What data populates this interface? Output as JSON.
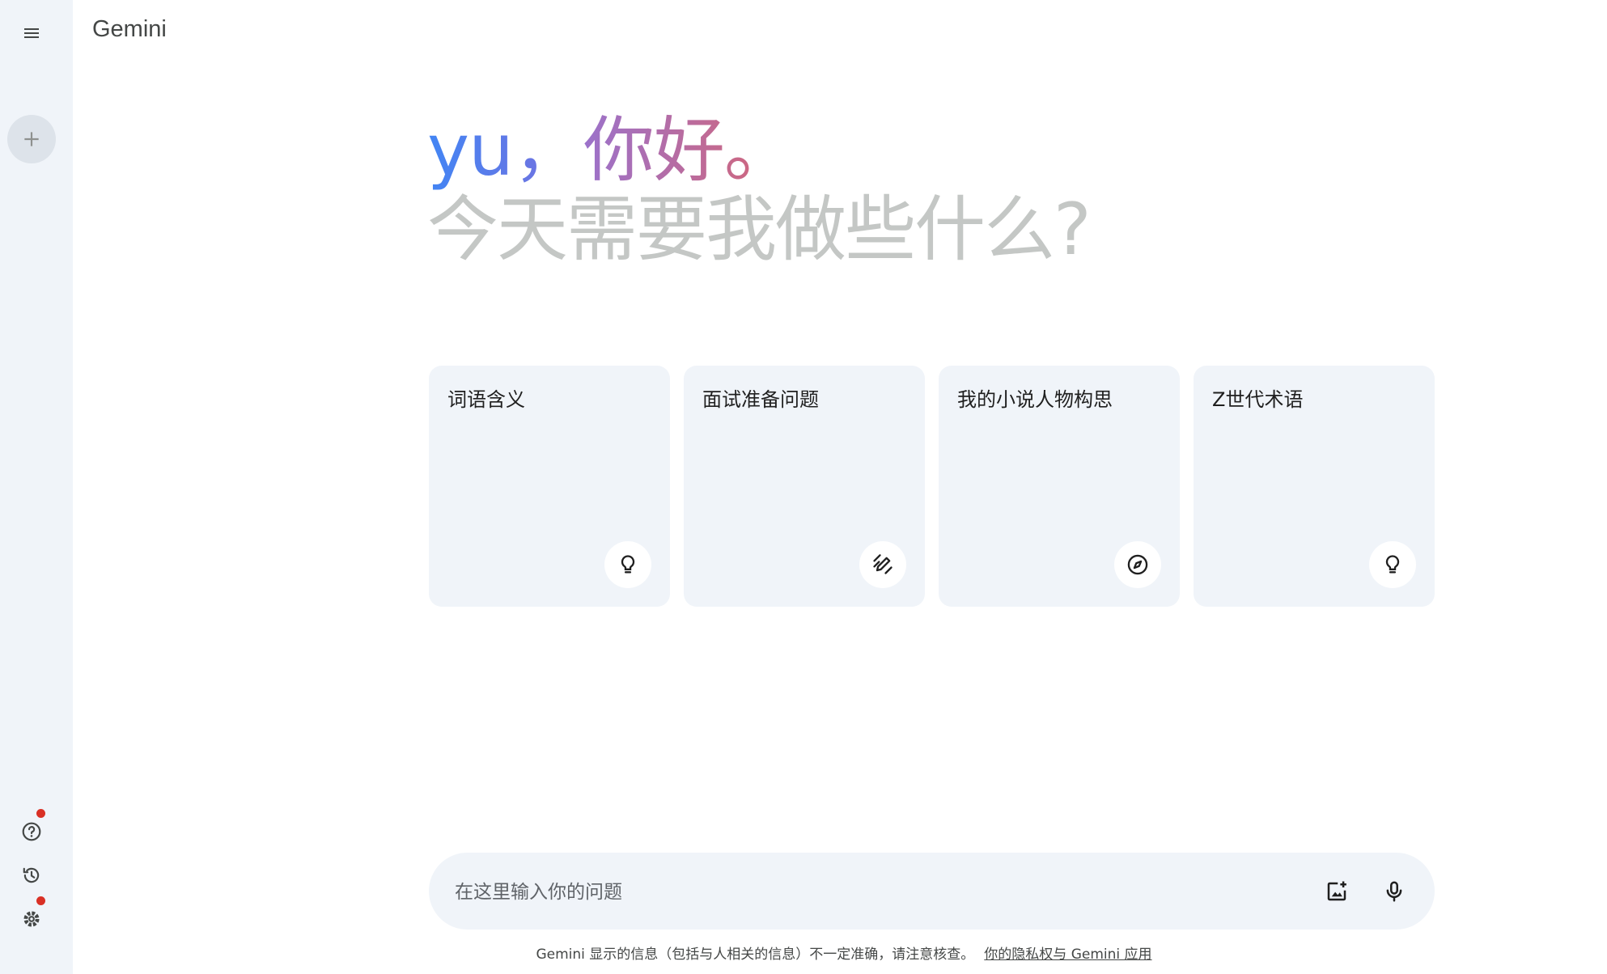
{
  "app": {
    "title": "Gemini"
  },
  "greeting": {
    "name": "yu，",
    "hello": "你好。",
    "prompt": "今天需要我做些什么?"
  },
  "cards": [
    {
      "label": "词语含义",
      "icon": "lightbulb-icon"
    },
    {
      "label": "面试准备问题",
      "icon": "edit-pen-icon"
    },
    {
      "label": "我的小说人物构思",
      "icon": "compass-icon"
    },
    {
      "label": "Z世代术语",
      "icon": "lightbulb-icon"
    }
  ],
  "input": {
    "placeholder": "在这里输入你的问题"
  },
  "footer": {
    "disclaimer": "Gemini 显示的信息（包括与人相关的信息）不一定准确，请注意核查。",
    "privacy_link": "你的隐私权与 Gemini 应用"
  },
  "colors": {
    "sidebar_bg": "#f0f4f9",
    "notification_dot": "#d93025",
    "card_bg": "#f0f4f9"
  }
}
